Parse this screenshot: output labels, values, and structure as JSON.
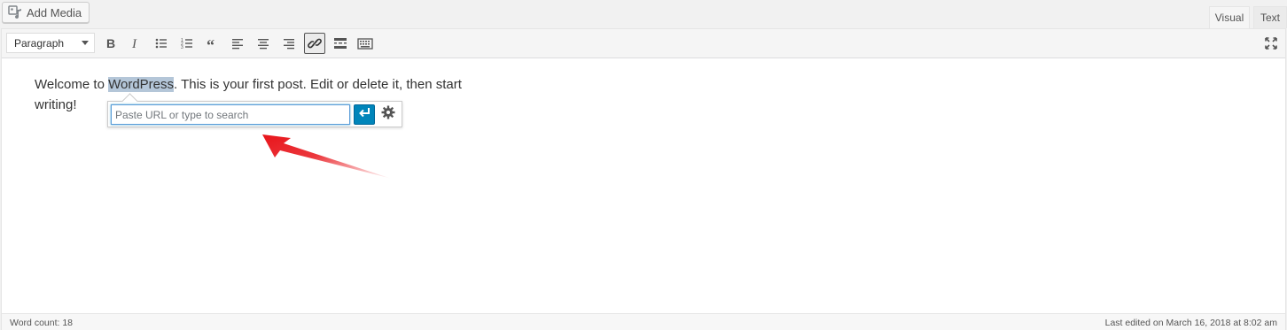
{
  "header": {
    "add_media_label": "Add Media",
    "tabs": [
      {
        "label": "Visual",
        "active": true
      },
      {
        "label": "Text",
        "active": false
      }
    ]
  },
  "toolbar": {
    "format_select_value": "Paragraph",
    "buttons": [
      {
        "name": "bold",
        "icon": "bold-icon"
      },
      {
        "name": "italic",
        "icon": "italic-icon"
      },
      {
        "name": "bulleted-list",
        "icon": "bulleted-list-icon"
      },
      {
        "name": "numbered-list",
        "icon": "numbered-list-icon"
      },
      {
        "name": "blockquote",
        "icon": "quote-icon"
      },
      {
        "name": "align-left",
        "icon": "align-left-icon"
      },
      {
        "name": "align-center",
        "icon": "align-center-icon"
      },
      {
        "name": "align-right",
        "icon": "align-right-icon"
      },
      {
        "name": "insert-link",
        "icon": "link-icon",
        "active": true
      },
      {
        "name": "read-more",
        "icon": "read-more-icon"
      },
      {
        "name": "toolbar-toggle",
        "icon": "keyboard-icon"
      }
    ],
    "fullscreen_icon": "fullscreen-icon"
  },
  "content": {
    "before_link": "Welcome to ",
    "highlighted": "WordPress",
    "after_link": ". This is your first post. Edit or delete it, then start",
    "second_line": "writing!"
  },
  "link_popup": {
    "placeholder": "Paste URL or type to search",
    "value": "",
    "apply_icon": "return-arrow-icon",
    "settings_icon": "gear-icon"
  },
  "annotation": {
    "arrow_color": "#e8141a"
  },
  "status": {
    "word_count": "Word count: 18",
    "last_edited": "Last edited on March 16, 2018 at 8:02 am"
  },
  "colors": {
    "accent": "#0085ba",
    "selection_highlight": "#b4c6d8"
  }
}
